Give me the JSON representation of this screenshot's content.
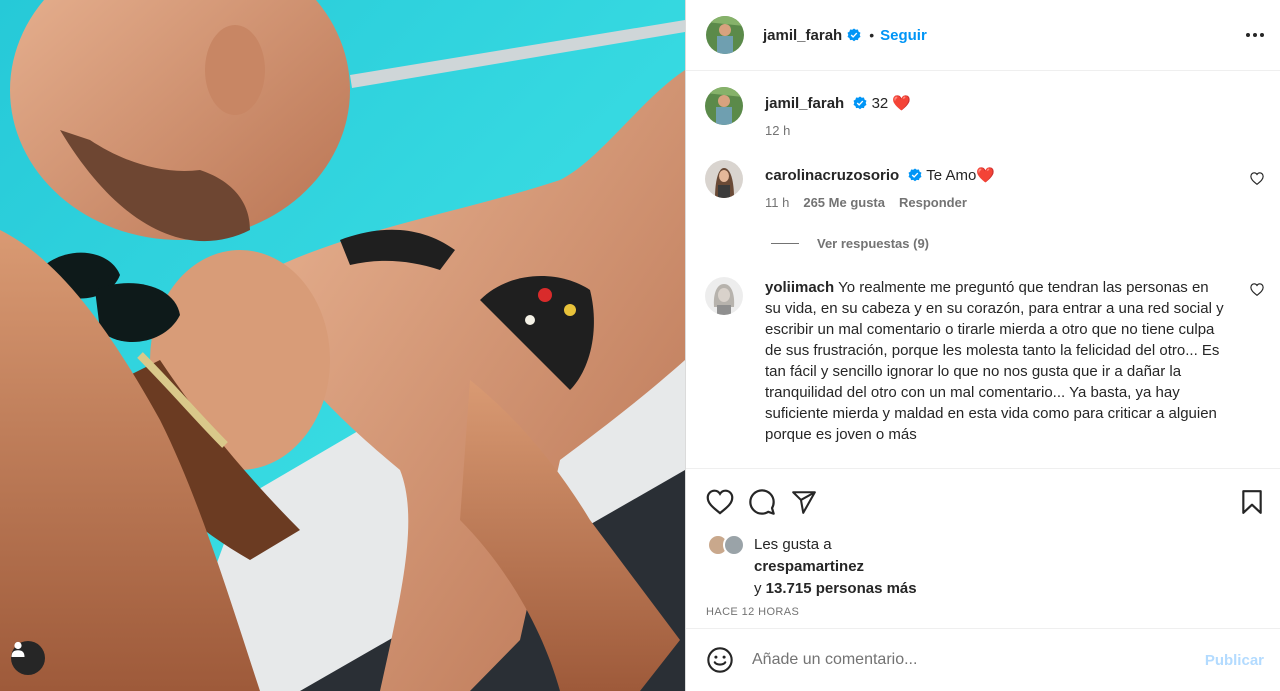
{
  "header": {
    "username": "jamil_farah",
    "separator": "•",
    "follow_label": "Seguir"
  },
  "caption": {
    "username": "jamil_farah",
    "text": "32",
    "emoji": "❤️",
    "time": "12 h"
  },
  "comments": [
    {
      "username": "carolinacruzosorio",
      "text": "Te Amo",
      "emoji": "❤️",
      "time": "11 h",
      "likes": "265 Me gusta",
      "reply_label": "Responder",
      "view_replies": "Ver respuestas (9)"
    },
    {
      "username": "yoliimach",
      "text": "Yo realmente me preguntó que tendran las personas en su vida, en su cabeza y en su corazón, para entrar a una red social y escribir un mal comentario o tirarle mierda a otro que no tiene culpa de sus frustración, porque les molesta tanto la felicidad del otro... Es tan fácil y sencillo ignorar lo que no nos gusta que ir a dañar la tranquilidad del otro con un mal comentario... Ya basta, ya hay suficiente mierda y maldad en esta vida como para criticar a alguien porque es joven o más"
    }
  ],
  "likes": {
    "prefix": "Les gusta a",
    "user": "crespamartinez",
    "connector": "y",
    "count": "13.715 personas más"
  },
  "timestamp": "HACE 12 HORAS",
  "add_comment": {
    "placeholder": "Añade un comentario...",
    "publish_label": "Publicar"
  },
  "colors": {
    "accent": "#0095f6",
    "publish_disabled": "#b3dbff",
    "heart": "#ed1c24",
    "sea": "#2ed3de"
  }
}
